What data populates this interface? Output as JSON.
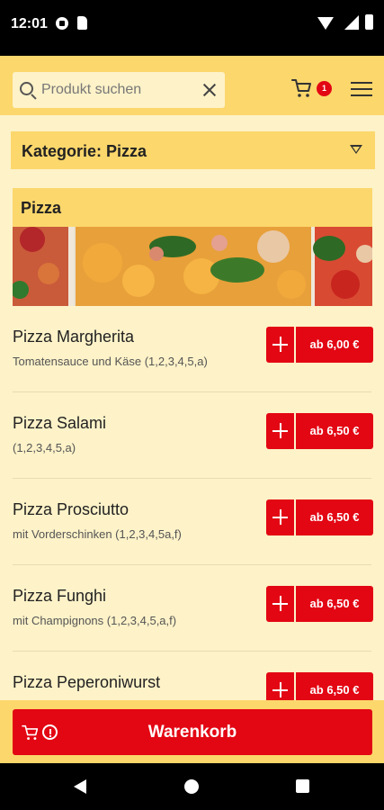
{
  "status": {
    "time": "12:01"
  },
  "header": {
    "search_placeholder": "Produkt suchen",
    "cart_count": "1"
  },
  "category": {
    "label": "Kategorie: Pizza"
  },
  "section": {
    "title": "Pizza"
  },
  "products": [
    {
      "name": "Pizza Margherita",
      "desc": "Tomatensauce und Käse (1,2,3,4,5,a)",
      "price": "ab 6,00 €"
    },
    {
      "name": "Pizza Salami",
      "desc": "(1,2,3,4,5,a)",
      "price": "ab 6,50 €"
    },
    {
      "name": "Pizza Prosciutto",
      "desc": "mit Vorderschinken (1,2,3,4,5a,f)",
      "price": "ab 6,50 €"
    },
    {
      "name": "Pizza Funghi",
      "desc": "mit Champignons (1,2,3,4,5,a,f)",
      "price": "ab 6,50 €"
    },
    {
      "name": "Pizza Peperoniwurst",
      "desc": "",
      "price": "ab 6,50 €"
    }
  ],
  "cart_bar": {
    "label": "Warenkorb"
  },
  "colors": {
    "accent": "#e30613",
    "header": "#fcd76c",
    "background": "#fdf2c8"
  }
}
